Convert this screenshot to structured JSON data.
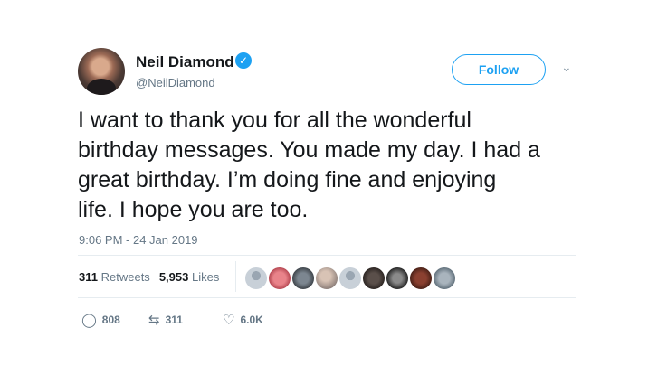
{
  "author": {
    "name": "Neil Diamond",
    "handle": "@NeilDiamond",
    "verified": true
  },
  "follow_label": "Follow",
  "tweet_text": "I want to thank you for all the wonderful\nbirthday messages. You made my day. I had a\ngreat birthday. I’m doing fine and enjoying\nlife. I hope you are too.",
  "timestamp": "9:06 PM - 24 Jan 2019",
  "stats": {
    "retweets_count": "311",
    "retweets_label": "Retweets",
    "likes_count": "5,953",
    "likes_label": "Likes"
  },
  "actions": {
    "replies": "808",
    "retweets": "311",
    "likes": "6.0K"
  },
  "colors": {
    "accent": "#1da1f2",
    "text": "#14171a",
    "muted": "#657786",
    "divider": "#e6ecf0"
  }
}
